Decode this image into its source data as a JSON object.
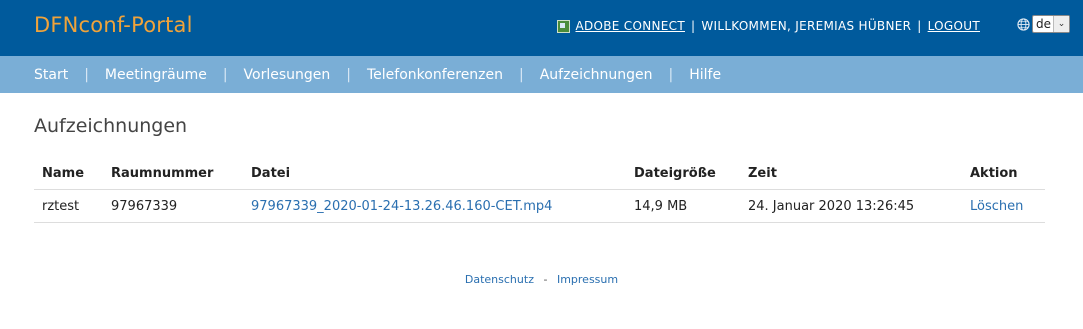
{
  "header": {
    "brand": "DFNconf-Portal",
    "adobe_connect_label": "ADOBE CONNECT",
    "welcome_text": "WILLKOMMEN, JEREMIAS HÜBNER",
    "logout_label": "LOGOUT",
    "language": {
      "selected": "de"
    }
  },
  "nav": {
    "items": [
      {
        "label": "Start"
      },
      {
        "label": "Meetingräume"
      },
      {
        "label": "Vorlesungen"
      },
      {
        "label": "Telefonkonferenzen"
      },
      {
        "label": "Aufzeichnungen"
      },
      {
        "label": "Hilfe"
      }
    ],
    "separator": "|"
  },
  "main": {
    "title": "Aufzeichnungen",
    "table": {
      "columns": [
        "Name",
        "Raumnummer",
        "Datei",
        "Dateigröße",
        "Zeit",
        "Aktion"
      ],
      "rows": [
        {
          "name": "rztest",
          "room_number": "97967339",
          "file": "97967339_2020-01-24-13.26.46.160-CET.mp4",
          "size": "14,9 MB",
          "time": "24. Januar 2020 13:26:45",
          "action": "Löschen"
        }
      ]
    }
  },
  "footer": {
    "privacy": "Datenschutz",
    "separator": "-",
    "imprint": "Impressum"
  },
  "colors": {
    "topbar": "#005a9c",
    "navbar": "#7aaed6",
    "brand": "#f0a33a",
    "link": "#2a6fb0"
  }
}
